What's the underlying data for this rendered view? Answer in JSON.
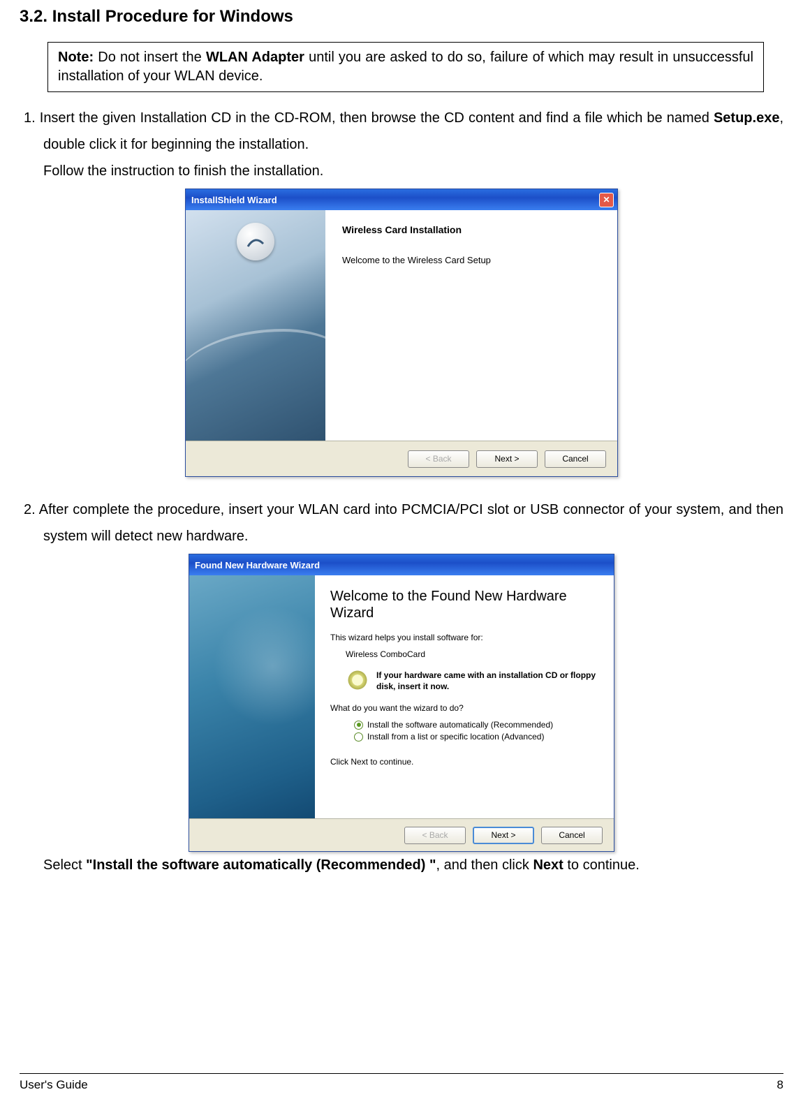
{
  "section_title": "3.2. Install Procedure for Windows",
  "note": {
    "prefix": "Note:",
    "pre": " Do not insert the ",
    "bold": "WLAN Adapter",
    "post": " until you are asked to do so, failure of which may result in unsuccessful installation of your WLAN device."
  },
  "step1": {
    "num": "1.",
    "line1_pre": "  Insert the given Installation CD in the CD-ROM, then browse the CD content and find a file which be named ",
    "line1_bold": "Setup.exe",
    "line1_post": ", double click it for beginning the installation.",
    "line2": "Follow the instruction to finish the installation."
  },
  "installshield": {
    "title": "InstallShield Wizard",
    "heading": "Wireless Card Installation",
    "text": "Welcome to the Wireless Card Setup",
    "back": "< Back",
    "next": "Next >",
    "cancel": "Cancel"
  },
  "step2": {
    "num": "2.",
    "text": " After complete the procedure, insert your WLAN card into PCMCIA/PCI slot or USB connector of your system, and then system will detect new hardware."
  },
  "hardware": {
    "title": "Found New Hardware Wizard",
    "heading": "Welcome to the Found New Hardware Wizard",
    "helps": "This wizard helps you install software for:",
    "device": "Wireless ComboCard",
    "cd_line": "If your hardware came with an installation CD or floppy disk, insert it now.",
    "question": "What do you want the wizard to do?",
    "opt1": "Install the software automatically (Recommended)",
    "opt2": "Install from a list or specific location (Advanced)",
    "click_next": "Click Next to continue.",
    "back": "< Back",
    "next": "Next >",
    "cancel": "Cancel"
  },
  "select_line": {
    "pre": "Select ",
    "bold1": "\"Install the software automatically (Recommended) \"",
    "mid": ", and then click ",
    "bold2": "Next",
    "post": " to continue."
  },
  "footer": {
    "left": "User's Guide",
    "right": "8"
  }
}
